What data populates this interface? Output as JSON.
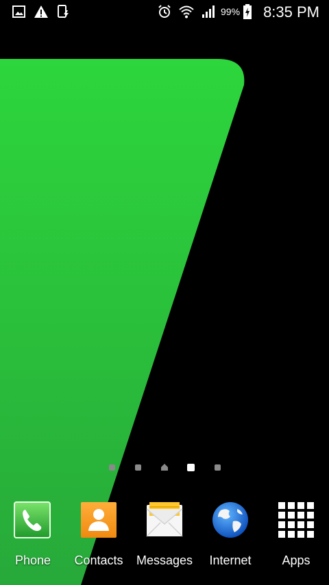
{
  "status_bar": {
    "left_icons": [
      "gallery-notification-icon",
      "warning-icon",
      "device-notification-icon"
    ],
    "right_icons": [
      "alarm-icon",
      "wifi-icon",
      "signal-icon",
      "battery-charging-icon"
    ],
    "battery_percent": "99%",
    "time": "8:35 PM"
  },
  "wallpaper": {
    "colors": {
      "green_top": "#2dd63c",
      "green_bottom": "#27b23a",
      "background": "#000000"
    }
  },
  "page_indicator": {
    "pages": [
      "page",
      "page",
      "home",
      "page",
      "page"
    ],
    "active_index": 3
  },
  "dock": {
    "apps": [
      {
        "label": "Phone",
        "icon": "phone-icon"
      },
      {
        "label": "Contacts",
        "icon": "contacts-icon"
      },
      {
        "label": "Messages",
        "icon": "messages-icon"
      },
      {
        "label": "Internet",
        "icon": "internet-globe-icon"
      },
      {
        "label": "Apps",
        "icon": "apps-grid-icon"
      }
    ]
  }
}
